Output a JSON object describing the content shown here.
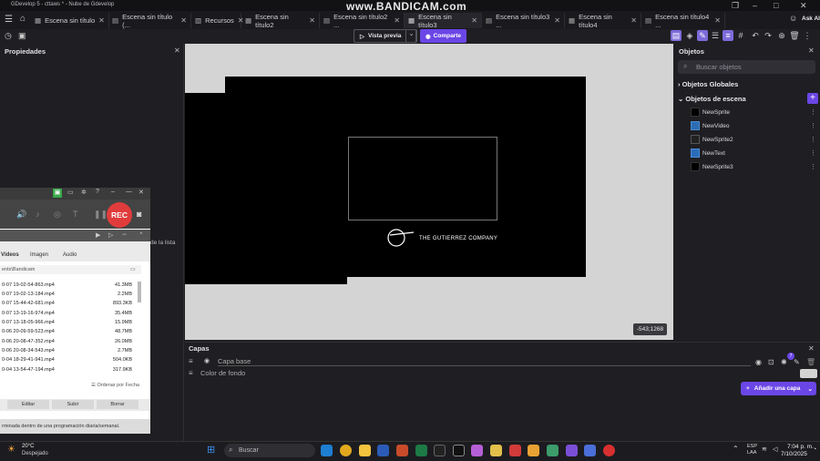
{
  "window": {
    "title": "GDevelop 5 - cttaws * - Nube de Gdevelop",
    "watermark": "www.BANDICAM.com"
  },
  "tabs": [
    {
      "label": "Escena sin título"
    },
    {
      "label": "Escena sin título (..."
    },
    {
      "label": "Recursos"
    },
    {
      "label": "Escena sin título2"
    },
    {
      "label": "Escena sin título2 ..."
    },
    {
      "label": "Escena sin título3",
      "active": true
    },
    {
      "label": "Escena sin título3 ..."
    },
    {
      "label": "Escena sin título4"
    },
    {
      "label": "Escena sin título4 ..."
    }
  ],
  "toolbar": {
    "preview_label": "Vista previa",
    "share_label": "Comparte",
    "ask_ai_label": "Ask AI"
  },
  "properties": {
    "title": "Propiedades",
    "list_hint": "de la lista"
  },
  "canvas": {
    "logo_text": "THE GUTIERREZ COMPANY",
    "coords": "-543;1268"
  },
  "objects": {
    "title": "Objetos",
    "search_placeholder": "Buscar objetos",
    "global_label": "Objetos Globales",
    "scene_label": "Objetos de escena",
    "items": [
      {
        "name": "NewSprite",
        "icon": "black-square-icon"
      },
      {
        "name": "NewVideo",
        "icon": "video-icon"
      },
      {
        "name": "NewSprite2",
        "icon": "sprite-icon"
      },
      {
        "name": "NewText",
        "icon": "text-icon"
      },
      {
        "name": "NewSprite3",
        "icon": "black-square-icon"
      }
    ]
  },
  "layers": {
    "title": "Capas",
    "base_layer": "Capa base",
    "bg_color_label": "Color de fondo",
    "add_layer_label": "Añadir una capa",
    "badge": "7"
  },
  "bandicam": {
    "rec_label": "REC",
    "tabs": [
      "Vídeos",
      "Imagen",
      "Audio"
    ],
    "path": "ents\\Bandicam",
    "files": [
      {
        "name": "0-07 19-02-54-863.mp4",
        "size": "41.3MB"
      },
      {
        "name": "0-07 19-02-13-184.mp4",
        "size": "2.2MB"
      },
      {
        "name": "0-07 15-44-42-681.mp4",
        "size": "893.3KB"
      },
      {
        "name": "0-07 13-19-16-974.mp4",
        "size": "35.4MB"
      },
      {
        "name": "0-07 13-18-05-966.mp4",
        "size": "15.9MB"
      },
      {
        "name": "0-06 20-09-59-523.mp4",
        "size": "48.7MB"
      },
      {
        "name": "0-06 20-08-47-352.mp4",
        "size": "26.0MB"
      },
      {
        "name": "0-06 20-08-34-543.mp4",
        "size": "2.7MB"
      },
      {
        "name": "0-04 18-29-41-941.mp4",
        "size": "504.0KB"
      },
      {
        "name": "0-04 13-54-47-194.mp4",
        "size": "317.9KB"
      }
    ],
    "sort_label": "Ordenar por Fecha",
    "buttons": [
      "Editar",
      "Subir",
      "Borrar"
    ],
    "footer": "rminada dentro de una programación diaria/semanal."
  },
  "taskbar": {
    "temp": "20°C",
    "weather": "Despejado",
    "search_placeholder": "Buscar",
    "lang_line1": "ESP",
    "lang_line2": "LAA",
    "time": "7:04 p. m.",
    "date": "7/10/2025"
  },
  "colors": {
    "accent": "#6b46e6",
    "canvas_bg": "#d4d4d4",
    "rec": "#e03c3c"
  }
}
